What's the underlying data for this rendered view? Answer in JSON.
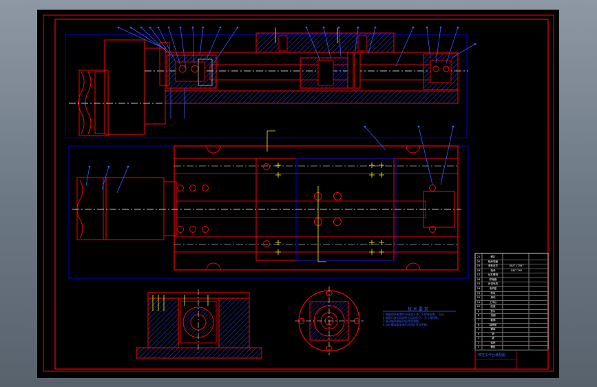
{
  "drawing": {
    "description": "",
    "colors": {
      "viewport_background": "#000000",
      "frame": "#ff0000",
      "dimension": "#0000ff",
      "hatch": "#0000cc",
      "centerline": "#ffffff",
      "leader": "#3b5bff",
      "accent": "#ffff00",
      "app_background": "#7b8794"
    }
  },
  "technical_notes": {
    "title": "技 术 要 求",
    "lines": [
      "1.装配前所有零件须清洗干净，不得有毛刺、飞边。",
      "2.装配后各运动部件应运动灵活，无卡滞现象。",
      "3.滚动轴承装配时应涂润滑脂。",
      "4.丝杠螺母副安装后应保证传动平稳。"
    ]
  },
  "title_block": {
    "drawing_name": "数控工作台装配图"
  },
  "parts_list": {
    "rows": [
      [
        "21",
        "螺钉",
        ""
      ],
      [
        "20",
        "轴承端盖",
        ""
      ],
      [
        "19",
        "滚珠丝杠",
        "GB/T 17587"
      ],
      [
        "18",
        "轴承",
        "GB/T 292"
      ],
      [
        "17",
        "丝杠螺母",
        ""
      ],
      [
        "16",
        "联轴器",
        ""
      ],
      [
        "15",
        "步进电机",
        ""
      ],
      [
        "14",
        "电机座",
        ""
      ],
      [
        "13",
        "导轨",
        ""
      ],
      [
        "12",
        "滑块",
        ""
      ],
      [
        "11",
        "工作台",
        ""
      ],
      [
        "10",
        "底座",
        ""
      ],
      [
        "9",
        "垫片",
        ""
      ],
      [
        "8",
        "挡圈",
        ""
      ],
      [
        "7",
        "套筒",
        ""
      ],
      [
        "6",
        "轴承座",
        ""
      ],
      [
        "5",
        "螺母",
        ""
      ],
      [
        "4",
        "销",
        ""
      ],
      [
        "3",
        "键",
        ""
      ],
      [
        "2",
        "油杯",
        ""
      ],
      [
        "1",
        "螺栓",
        ""
      ]
    ]
  }
}
